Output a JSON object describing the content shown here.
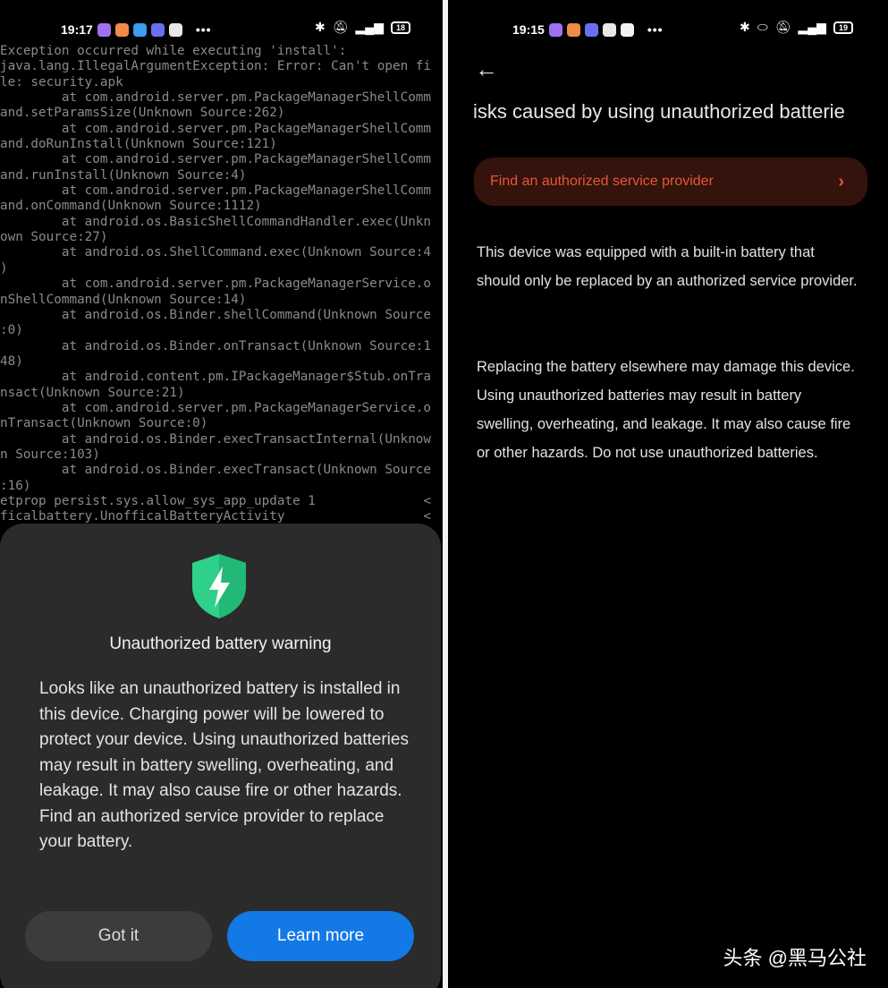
{
  "left": {
    "status": {
      "time": "19:17",
      "battery": "18",
      "app_icons": [
        "messenger",
        "orange-app",
        "twitter",
        "discord",
        "google-drive"
      ]
    },
    "terminal_lines": [
      "Exception occurred while executing 'install':",
      "java.lang.IllegalArgumentException: Error: Can't open fi",
      "le: security.apk",
      "        at com.android.server.pm.PackageManagerShellComm",
      "and.setParamsSize(Unknown Source:262)",
      "        at com.android.server.pm.PackageManagerShellComm",
      "and.doRunInstall(Unknown Source:121)",
      "        at com.android.server.pm.PackageManagerShellComm",
      "and.runInstall(Unknown Source:4)",
      "        at com.android.server.pm.PackageManagerShellComm",
      "and.onCommand(Unknown Source:1112)",
      "        at android.os.BasicShellCommandHandler.exec(Unkn",
      "own Source:27)",
      "        at android.os.ShellCommand.exec(Unknown Source:4",
      ")",
      "        at com.android.server.pm.PackageManagerService.o",
      "nShellCommand(Unknown Source:14)",
      "        at android.os.Binder.shellCommand(Unknown Source",
      ":0)",
      "        at android.os.Binder.onTransact(Unknown Source:1",
      "48)",
      "        at android.content.pm.IPackageManager$Stub.onTra",
      "nsact(Unknown Source:21)",
      "        at com.android.server.pm.PackageManagerService.o",
      "nTransact(Unknown Source:0)",
      "        at android.os.Binder.execTransactInternal(Unknow",
      "n Source:103)",
      "        at android.os.Binder.execTransact(Unknown Source",
      ":16)",
      "etprop persist.sys.allow_sys_app_update 1              <",
      "ficalbattery.UnofficalBatteryActivity                  <"
    ],
    "dialog": {
      "icon": "shield-bolt-icon",
      "title": "Unauthorized battery warning",
      "body": "Looks like an unauthorized battery is installed in this device. Charging power will be lowered to protect your device. Using unauthorized batteries may result in battery swelling, overheating, and leakage. It may also cause fire or other hazards. Find an authorized service provider to replace your battery.",
      "got_it": "Got it",
      "learn_more": "Learn more"
    }
  },
  "right": {
    "status": {
      "time": "19:15",
      "battery": "19",
      "app_icons": [
        "messenger",
        "orange-app",
        "discord",
        "google-drive",
        "google"
      ]
    },
    "title": "isks caused by using unauthorized batterie",
    "find_button": "Find an authorized service provider",
    "paragraphs": [
      "This device was equipped with a built-in battery that should only be replaced by an authorized service provider.",
      "Replacing the battery elsewhere may damage this device. Using unauthorized batteries may result in battery swelling, overheating, and leakage. It may also cause fire or other hazards. Do not use unauthorized batteries."
    ]
  },
  "watermark": "头条 @黑马公社",
  "colors": {
    "accent_blue": "#1279e6",
    "warning_red": "#e8553b",
    "shield_green": "#2fd08a"
  }
}
